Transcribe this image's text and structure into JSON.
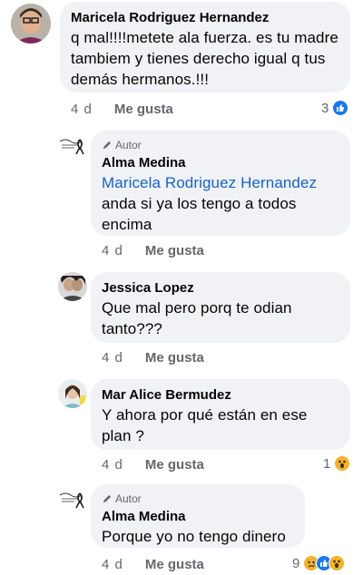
{
  "comments": [
    {
      "author": "Maricela Rodriguez Hernandez",
      "text": "q mal!!!!metete ala fuerza. es tu madre tambiem y tienes derecho igual q tus demás hermanos.!!!",
      "time": "4 d",
      "like_label": "Me gusta",
      "reaction_count": "3"
    },
    {
      "badge": "Autor",
      "author": "Alma Medina",
      "mention": "Maricela Rodriguez Hernandez",
      "text": "anda si ya los tengo a todos encima",
      "time": "4 d",
      "like_label": "Me gusta"
    },
    {
      "author": "Jessica Lopez",
      "text": "Que mal pero porq te odian tanto???",
      "time": "4 d",
      "like_label": "Me gusta"
    },
    {
      "author": "Mar Alice Bermudez",
      "text": "Y ahora por qué están en ese plan ?",
      "time": "4 d",
      "like_label": "Me gusta",
      "reaction_count": "1"
    },
    {
      "badge": "Autor",
      "author": "Alma Medina",
      "text": "Porque yo no tengo dinero",
      "time": "4 d",
      "like_label": "Me gusta",
      "reaction_count": "9"
    }
  ],
  "colors": {
    "bubble": "#f0f2f5",
    "like": "#1877f2",
    "mention": "#1763cf",
    "meta": "#65676b"
  }
}
